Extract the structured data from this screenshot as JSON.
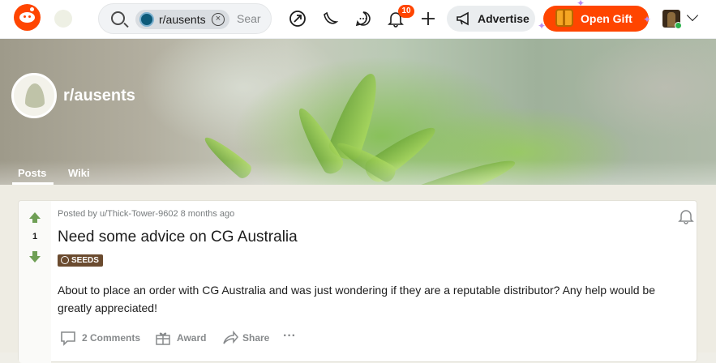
{
  "topbar": {
    "search": {
      "community_chip": "r/ausents",
      "chip_remove": "×",
      "placeholder": "Sear"
    },
    "notifications_count": "10",
    "advertise_label": "Advertise",
    "gift_label": "Open Gift"
  },
  "community": {
    "name": "r/ausents",
    "tabs": [
      {
        "label": "Posts",
        "active": true
      },
      {
        "label": "Wiki",
        "active": false
      }
    ]
  },
  "post": {
    "score": "1",
    "meta": "Posted by u/Thick-Tower-9602 8 months ago",
    "title": "Need some advice on CG Australia",
    "flair": "SEEDS",
    "body": "About to place an order with CG Australia and was just wondering if they are a reputable distributor? Any help would be greatly appreciated!",
    "actions": {
      "comments": "2 Comments",
      "award": "Award",
      "share": "Share",
      "more": "···"
    }
  },
  "colors": {
    "brand": "#ff4500",
    "vote_green": "#6f9f55",
    "flair_bg": "#6b4b2f"
  }
}
